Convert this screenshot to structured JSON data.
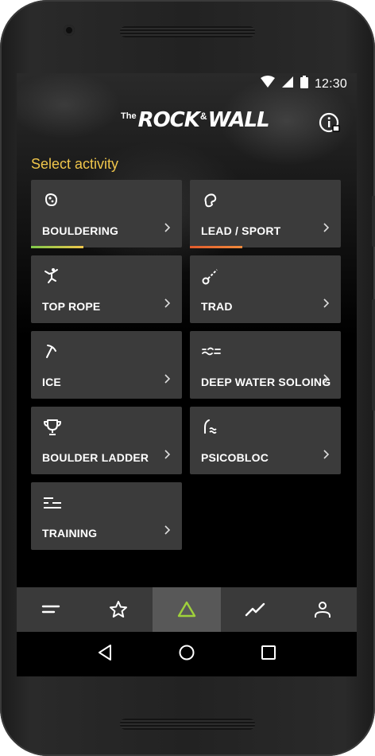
{
  "status_bar": {
    "time": "12:30"
  },
  "header": {
    "logo_small": "The",
    "logo_rock": "ROCK",
    "logo_amp": "&",
    "logo_wall": "WALL"
  },
  "section_title": "Select activity",
  "activities": [
    {
      "label": "BOULDERING",
      "icon": "hold-icon",
      "grade_gradient": [
        "#7fc94a",
        "#f0c64b"
      ]
    },
    {
      "label": "LEAD / SPORT",
      "icon": "hold-outline-icon",
      "grade_gradient": [
        "#e25b2c",
        "#f08a3c"
      ]
    },
    {
      "label": "TOP ROPE",
      "icon": "climber-icon"
    },
    {
      "label": "TRAD",
      "icon": "cam-icon"
    },
    {
      "label": "ICE",
      "icon": "ice-axe-icon"
    },
    {
      "label": "DEEP WATER SOLOING",
      "icon": "waves-icon"
    },
    {
      "label": "BOULDER LADDER",
      "icon": "trophy-icon"
    },
    {
      "label": "PSICOBLOC",
      "icon": "wave-wall-icon"
    },
    {
      "label": "TRAINING",
      "icon": "sliders-icon"
    }
  ],
  "bottom_nav": [
    {
      "icon": "menu-icon",
      "active": false
    },
    {
      "icon": "star-icon",
      "active": false
    },
    {
      "icon": "triangle-icon",
      "active": true
    },
    {
      "icon": "trend-icon",
      "active": false
    },
    {
      "icon": "person-icon",
      "active": false
    }
  ],
  "colors": {
    "accent": "#f0c64b",
    "active_nav": "#9fd13b",
    "card": "#3b3b3b"
  }
}
